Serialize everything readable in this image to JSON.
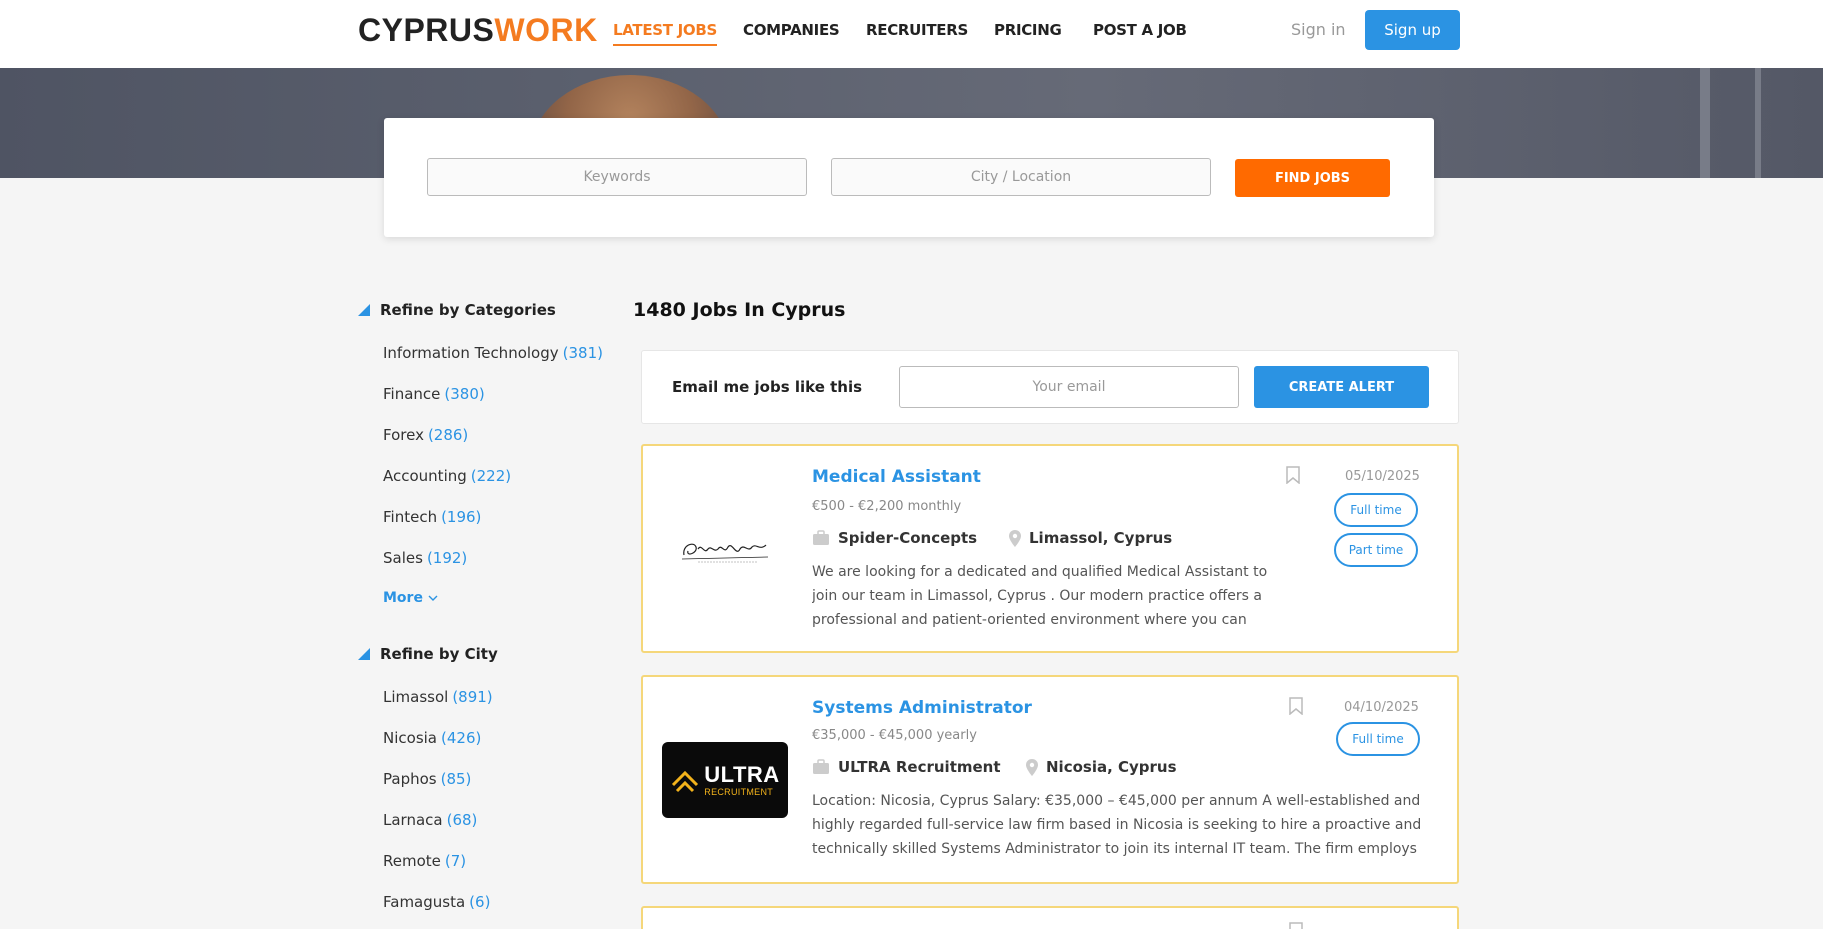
{
  "header": {
    "logo_part1": "CYPRUS",
    "logo_part2": "WORK",
    "nav": [
      {
        "label": "LATEST JOBS"
      },
      {
        "label": "COMPANIES"
      },
      {
        "label": "RECRUITERS"
      },
      {
        "label": "PRICING"
      },
      {
        "label": "POST A JOB"
      }
    ],
    "signin": "Sign in",
    "signup": "Sign up"
  },
  "search": {
    "keywords_placeholder": "Keywords",
    "location_placeholder": "City / Location",
    "button": "FIND JOBS"
  },
  "sidebar": {
    "categories_title": "Refine by Categories",
    "categories": [
      {
        "label": "Information Technology",
        "count": "(381)"
      },
      {
        "label": "Finance",
        "count": "(380)"
      },
      {
        "label": "Forex",
        "count": "(286)"
      },
      {
        "label": "Accounting",
        "count": "(222)"
      },
      {
        "label": "Fintech",
        "count": "(196)"
      },
      {
        "label": "Sales",
        "count": "(192)"
      }
    ],
    "more": "More",
    "city_title": "Refine by City",
    "cities": [
      {
        "label": "Limassol",
        "count": "(891)"
      },
      {
        "label": "Nicosia",
        "count": "(426)"
      },
      {
        "label": "Paphos",
        "count": "(85)"
      },
      {
        "label": "Larnaca",
        "count": "(68)"
      },
      {
        "label": "Remote",
        "count": "(7)"
      },
      {
        "label": "Famagusta",
        "count": "(6)"
      }
    ]
  },
  "main": {
    "jobs_count": "1480 Jobs In Cyprus",
    "alert": {
      "label": "Email me jobs like this",
      "placeholder": "Your email",
      "button": "CREATE ALERT"
    },
    "jobs": [
      {
        "title": "Medical Assistant",
        "salary": "€500 - €2,200 monthly",
        "company": "Spider-Concepts",
        "location": "Limassol, Cyprus",
        "description": "We are looking for a dedicated and qualified Medical Assistant to join our team in Limassol, Cyprus . Our modern practice offers a professional and patient-oriented environment where you can",
        "date": "05/10/2025",
        "types": [
          "Full time",
          "Part time"
        ]
      },
      {
        "title": "Systems Administrator",
        "salary": "€35,000 - €45,000 yearly",
        "company": "ULTRA Recruitment",
        "location": "Nicosia, Cyprus",
        "description": "Location:  Nicosia, Cyprus Salary:  €35,000 – €45,000 per annum A well-established and highly regarded full-service law firm based in Nicosia is seeking to hire a proactive and technically skilled  Systems Administrator  to join its internal IT team. The firm employs",
        "date": "04/10/2025",
        "types": [
          "Full time"
        ],
        "logo_text_1": "ULTRA",
        "logo_text_2": "RECRUITMENT"
      }
    ]
  },
  "colors": {
    "brand_orange": "#f47b20",
    "accent_blue": "#2b93e3",
    "find_button": "#ff6a00",
    "card_border": "#f5d77a"
  }
}
